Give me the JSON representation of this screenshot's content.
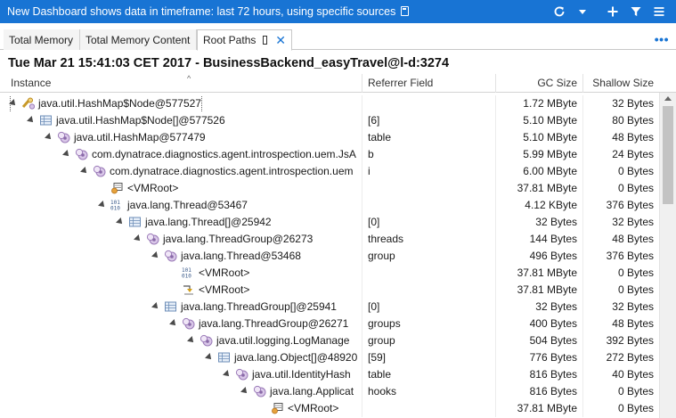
{
  "topbar": {
    "title": "New Dashboard shows data in timeframe: last 72 hours, using specific sources"
  },
  "tabs": [
    {
      "label": "Total Memory",
      "active": false
    },
    {
      "label": "Total Memory Content",
      "active": false
    },
    {
      "label": "Root Paths",
      "active": true
    }
  ],
  "snapshot_title": "Tue Mar 21 15:41:03 CET 2017 - BusinessBackend_easyTravel@l-d:3274",
  "columns": {
    "instance": "Instance",
    "referrer": "Referrer Field",
    "gc_size": "GC Size",
    "shallow_size": "Shallow Size"
  },
  "icons": {
    "refresh": "refresh-icon",
    "dropdown": "chevron-down-icon",
    "add": "plus-icon",
    "filter": "filter-icon",
    "menu": "menu-icon",
    "close": "close-icon"
  },
  "rows": [
    {
      "depth": 0,
      "icon": "hashmap-node",
      "instance": "java.util.HashMap$Node@577527",
      "referrer": "",
      "gc": "1.72 MByte",
      "shallow": "32 Bytes",
      "expand": true,
      "selected": true
    },
    {
      "depth": 1,
      "icon": "array",
      "instance": "java.util.HashMap$Node[]@577526",
      "referrer": "[6]",
      "gc": "5.10 MByte",
      "shallow": "80 Bytes",
      "expand": true
    },
    {
      "depth": 2,
      "icon": "object",
      "instance": "java.util.HashMap@577479",
      "referrer": "table",
      "gc": "5.10 MByte",
      "shallow": "48 Bytes",
      "expand": true
    },
    {
      "depth": 3,
      "icon": "object",
      "instance": "com.dynatrace.diagnostics.agent.introspection.uem.JsA",
      "referrer": "b",
      "gc": "5.99 MByte",
      "shallow": "24 Bytes",
      "expand": true
    },
    {
      "depth": 4,
      "icon": "object",
      "instance": "com.dynatrace.diagnostics.agent.introspection.uem",
      "referrer": "i",
      "gc": "6.00 MByte",
      "shallow": "0 Bytes",
      "expand": true
    },
    {
      "depth": 5,
      "icon": "vmroot",
      "instance": "<VMRoot>",
      "referrer": "",
      "gc": "37.81 MByte",
      "shallow": "0 Bytes",
      "expand": false
    },
    {
      "depth": 5,
      "icon": "thread",
      "instance": "java.lang.Thread@53467",
      "referrer": "",
      "gc": "4.12 KByte",
      "shallow": "376 Bytes",
      "expand": true
    },
    {
      "depth": 6,
      "icon": "array",
      "instance": "java.lang.Thread[]@25942",
      "referrer": "[0]",
      "gc": "32 Bytes",
      "shallow": "32 Bytes",
      "expand": true
    },
    {
      "depth": 7,
      "icon": "object",
      "instance": "java.lang.ThreadGroup@26273",
      "referrer": "threads",
      "gc": "144 Bytes",
      "shallow": "48 Bytes",
      "expand": true
    },
    {
      "depth": 8,
      "icon": "object",
      "instance": "java.lang.Thread@53468",
      "referrer": "group",
      "gc": "496 Bytes",
      "shallow": "376 Bytes",
      "expand": true
    },
    {
      "depth": 9,
      "icon": "thread",
      "instance": "<VMRoot>",
      "referrer": "",
      "gc": "37.81 MByte",
      "shallow": "0 Bytes",
      "expand": false
    },
    {
      "depth": 9,
      "icon": "vmroot-arrow",
      "instance": "<VMRoot>",
      "referrer": "",
      "gc": "37.81 MByte",
      "shallow": "0 Bytes",
      "expand": false
    },
    {
      "depth": 8,
      "icon": "array",
      "instance": "java.lang.ThreadGroup[]@25941",
      "referrer": "[0]",
      "gc": "32 Bytes",
      "shallow": "32 Bytes",
      "expand": true
    },
    {
      "depth": 9,
      "icon": "object",
      "instance": "java.lang.ThreadGroup@26271",
      "referrer": "groups",
      "gc": "400 Bytes",
      "shallow": "48 Bytes",
      "expand": true
    },
    {
      "depth": 10,
      "icon": "object",
      "instance": "java.util.logging.LogManage",
      "referrer": "group",
      "gc": "504 Bytes",
      "shallow": "392 Bytes",
      "expand": true
    },
    {
      "depth": 11,
      "icon": "array",
      "instance": "java.lang.Object[]@48920",
      "referrer": "[59]",
      "gc": "776 Bytes",
      "shallow": "272 Bytes",
      "expand": true
    },
    {
      "depth": 12,
      "icon": "object",
      "instance": "java.util.IdentityHash",
      "referrer": "table",
      "gc": "816 Bytes",
      "shallow": "40 Bytes",
      "expand": true
    },
    {
      "depth": 13,
      "icon": "object",
      "instance": "java.lang.Applicat",
      "referrer": "hooks",
      "gc": "816 Bytes",
      "shallow": "0 Bytes",
      "expand": true
    },
    {
      "depth": 14,
      "icon": "vmroot",
      "instance": "<VMRoot>",
      "referrer": "",
      "gc": "37.81 MByte",
      "shallow": "0 Bytes",
      "expand": false
    }
  ]
}
